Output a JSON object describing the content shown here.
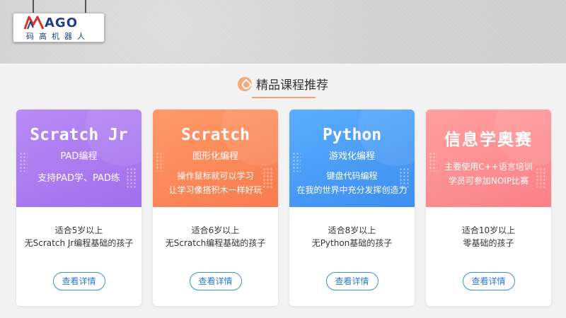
{
  "logo": {
    "mark": "M",
    "main": "AGO",
    "sub": "码高机器人"
  },
  "section": {
    "title": "精品课程推荐",
    "icon": "ribbon-icon"
  },
  "cards": [
    {
      "title": "Scratch Jr",
      "subtitle": "PAD编程",
      "desc1": "支持PAD学、PAD练",
      "desc2": "",
      "body1": "适合5岁以上",
      "body2": "无Scratch Jr编程基础的孩子",
      "button": "查看详情",
      "color": "#a879ee"
    },
    {
      "title": "Scratch",
      "subtitle": "图形化编程",
      "desc1": "操作鼠标就可以学习",
      "desc2": "让学习像搭积木一样好玩",
      "body1": "适合6岁以上",
      "body2": "无Scratch编程基础的孩子",
      "button": "查看详情",
      "color": "#fb8858"
    },
    {
      "title": "Python",
      "subtitle": "游戏化编程",
      "desc1": "键盘代码编程",
      "desc2": "在我的世界中充分发挥创造力",
      "body1": "适合8岁以上",
      "body2": "无Python基础的孩子",
      "button": "查看详情",
      "color": "#4a9af6"
    },
    {
      "title": "信息学奥赛",
      "subtitle": "",
      "desc1": "主要使用C++语言培训",
      "desc2": "学员可参加NOIP比赛",
      "body1": "适合10岁以上",
      "body2": "零基础的孩子",
      "button": "查看详情",
      "color": "#fb8c8f"
    }
  ]
}
